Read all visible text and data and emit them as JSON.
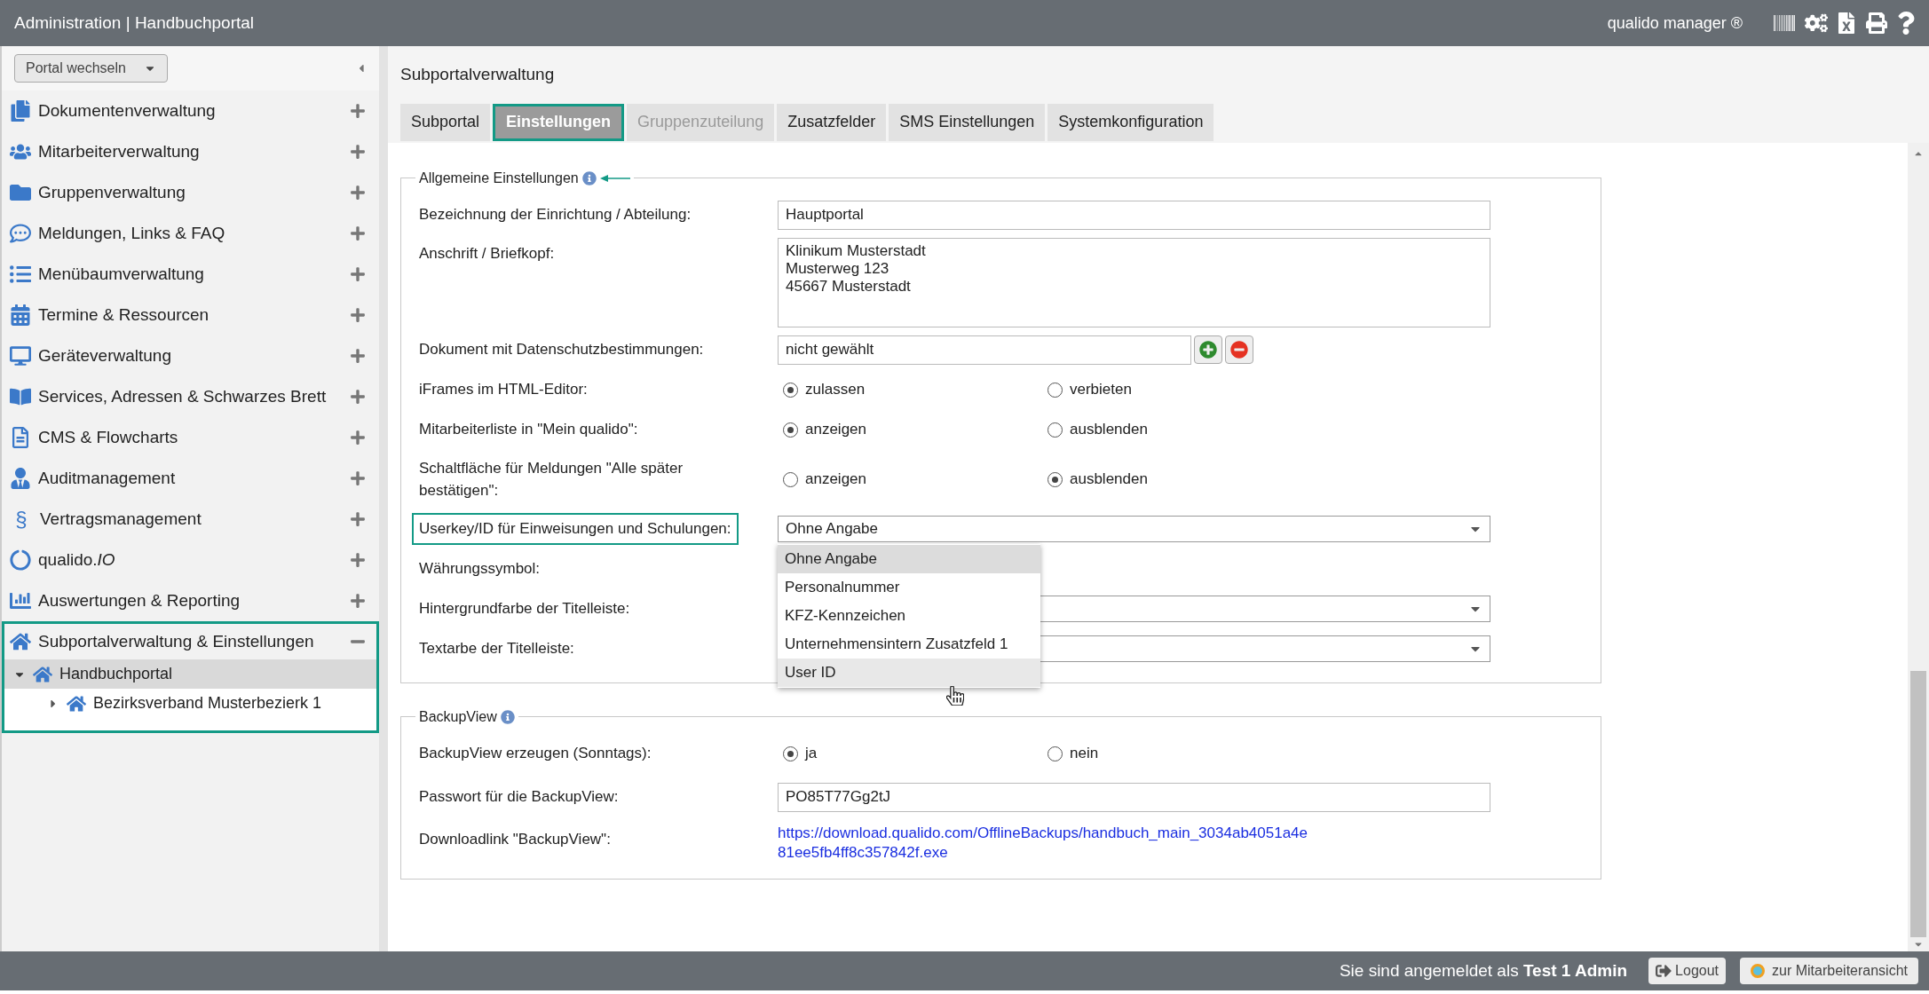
{
  "header": {
    "title": "Administration | Handbuchportal",
    "product": "qualido manager ®"
  },
  "sidebar": {
    "portal_button": "Portal wechseln",
    "items": [
      {
        "label": "Dokumentenverwaltung",
        "expanded": false,
        "highlighted": false
      },
      {
        "label": "Mitarbeiterverwaltung",
        "expanded": false,
        "highlighted": false
      },
      {
        "label": "Gruppenverwaltung",
        "expanded": false,
        "highlighted": false
      },
      {
        "label": "Meldungen, Links & FAQ",
        "expanded": false,
        "highlighted": false
      },
      {
        "label": "Menübaumverwaltung",
        "expanded": false,
        "highlighted": false
      },
      {
        "label": "Termine & Ressourcen",
        "expanded": false,
        "highlighted": false
      },
      {
        "label": "Geräteverwaltung",
        "expanded": false,
        "highlighted": false
      },
      {
        "label": "Services, Adressen & Schwarzes Brett",
        "expanded": false,
        "highlighted": false
      },
      {
        "label": "CMS & Flowcharts",
        "expanded": false,
        "highlighted": false
      },
      {
        "label": "Auditmanagement",
        "expanded": false,
        "highlighted": false
      },
      {
        "label": "Vertragsmanagement",
        "glyph": "§",
        "expanded": false,
        "highlighted": false
      },
      {
        "label": "qualido.*IO*",
        "expanded": false,
        "highlighted": false
      },
      {
        "label": "Auswertungen & Reporting",
        "expanded": false,
        "highlighted": false
      },
      {
        "label": "Subportalverwaltung & Einstellungen",
        "expanded": true,
        "highlighted": true,
        "children": [
          {
            "label": "Handbuchportal",
            "expanded": true,
            "selected": true,
            "children": [
              {
                "label": "Bezirksverband Musterbezierk 1",
                "expanded": false,
                "selected": false
              }
            ]
          }
        ]
      }
    ]
  },
  "page_title": "Subportalverwaltung",
  "tabs": [
    {
      "label": "Subportal",
      "selected": false,
      "disabled": false
    },
    {
      "label": "Einstellungen",
      "selected": true,
      "disabled": false
    },
    {
      "label": "Gruppenzuteilung",
      "selected": false,
      "disabled": true
    },
    {
      "label": "Zusatzfelder",
      "selected": false,
      "disabled": false
    },
    {
      "label": "SMS Einstellungen",
      "selected": false,
      "disabled": false
    },
    {
      "label": "Systemkonfiguration",
      "selected": false,
      "disabled": false
    }
  ],
  "sections": [
    {
      "title": "Allgemeine Einstellungen",
      "annotated": true,
      "rows": [
        {
          "kind": "text",
          "label": "Bezeichnung der Einrichtung / Abteilung:",
          "value": "Hauptportal"
        },
        {
          "kind": "textarea",
          "label": "Anschrift / Briefkopf:",
          "value": "Klinikum Musterstadt\nMusterweg 123\n45667 Musterstadt"
        },
        {
          "kind": "document",
          "label": "Dokument mit Datenschutzbestimmungen:",
          "value": "nicht gewählt"
        },
        {
          "kind": "radio",
          "label": "iFrames im HTML-Editor:",
          "options": [
            {
              "label": "zulassen",
              "selected": true
            },
            {
              "label": "verbieten",
              "selected": false
            }
          ]
        },
        {
          "kind": "radio",
          "label": "Mitarbeiterliste in \"Mein qualido\":",
          "options": [
            {
              "label": "anzeigen",
              "selected": true
            },
            {
              "label": "ausblenden",
              "selected": false
            }
          ]
        },
        {
          "kind": "radio",
          "label": "Schaltfläche für Meldungen \"Alle später bestätigen\":",
          "options": [
            {
              "label": "anzeigen",
              "selected": false
            },
            {
              "label": "ausblenden",
              "selected": true
            }
          ]
        },
        {
          "kind": "select",
          "label": "Userkey/ID für Einweisungen und Schulungen:",
          "value": "Ohne Angabe",
          "highlighted": true,
          "open": true,
          "options": [
            {
              "label": "Ohne Angabe",
              "selected": true,
              "hovered": false
            },
            {
              "label": "Personalnummer",
              "selected": false,
              "hovered": false
            },
            {
              "label": "KFZ-Kennzeichen",
              "selected": false,
              "hovered": false
            },
            {
              "label": "Unternehmensintern Zusatzfeld 1",
              "selected": false,
              "hovered": false
            },
            {
              "label": "User ID",
              "selected": false,
              "hovered": true
            }
          ]
        },
        {
          "kind": "hidden",
          "label": "Währungssymbol:"
        },
        {
          "kind": "select",
          "label": "Hintergrundfarbe der Titelleiste:"
        },
        {
          "kind": "select",
          "label": "Textarbe der Titelleiste:"
        }
      ]
    },
    {
      "title": "BackupView",
      "annotated": false,
      "rows": [
        {
          "kind": "radio",
          "label": "BackupView erzeugen (Sonntags):",
          "options": [
            {
              "label": "ja",
              "selected": true
            },
            {
              "label": "nein",
              "selected": false
            }
          ]
        },
        {
          "kind": "text",
          "label": "Passwort für die BackupView:",
          "value": "PO85T77Gg2tJ"
        },
        {
          "kind": "link",
          "label": "Downloadlink \"BackupView\":",
          "value": "https://download.qualido.com/OfflineBackups/handbuch_main_3034ab4051a4e 81ee5fb4ff8c357842f.exe"
        }
      ]
    }
  ],
  "footer": {
    "login_text": "Sie sind angemeldet als **Test 1 Admin**",
    "logout": "Logout",
    "staff_view": "zur Mitarbeiteransicht"
  }
}
